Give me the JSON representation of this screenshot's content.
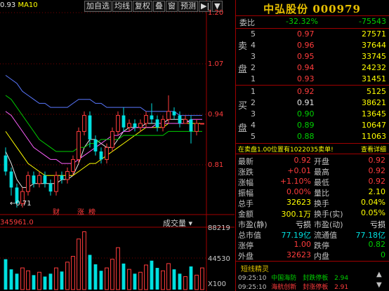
{
  "legend": {
    "ma_prefix": "0.93",
    "ma_label": "MA10"
  },
  "toolbar": [
    "加自选",
    "均线",
    "复权",
    "叠",
    "窗",
    "预测"
  ],
  "toolbar_icons": [
    "play-last-icon",
    "menu-arrow-icon"
  ],
  "price_axis": [
    "1.20",
    "1.07",
    "0.94",
    "0.81"
  ],
  "low_marker": "0.71",
  "chart_markers": [
    "财",
    "涨",
    "榜"
  ],
  "volume": {
    "header": "345961.0",
    "selector": "成交量",
    "axis": [
      "88219",
      "44530",
      "X100"
    ]
  },
  "stock": {
    "name": "中弘股份",
    "code": "000979"
  },
  "committee": {
    "label": "委比",
    "ratio": "-32.32%",
    "diff": "-75543"
  },
  "sell_side_label": [
    "卖",
    "盘"
  ],
  "buy_side_label": [
    "买",
    "盘"
  ],
  "sell_orders": [
    {
      "level": "5",
      "price": "0.97",
      "volume": "27571"
    },
    {
      "level": "4",
      "price": "0.96",
      "volume": "37644"
    },
    {
      "level": "3",
      "price": "0.95",
      "volume": "33745"
    },
    {
      "level": "2",
      "price": "0.94",
      "volume": "24232"
    },
    {
      "level": "1",
      "price": "0.93",
      "volume": "31451"
    }
  ],
  "buy_orders": [
    {
      "level": "1",
      "price": "0.92",
      "volume": "5125"
    },
    {
      "level": "2",
      "price": "0.91",
      "volume": "38621"
    },
    {
      "level": "3",
      "price": "0.90",
      "volume": "13645"
    },
    {
      "level": "4",
      "price": "0.89",
      "volume": "10647"
    },
    {
      "level": "5",
      "price": "0.88",
      "volume": "11063"
    }
  ],
  "hint": {
    "text_a": "在卖盘1.00位置有",
    "amount": "1022035",
    "text_b": "卖单!",
    "link": "查看详细"
  },
  "stats_left": [
    {
      "label": "最新",
      "value": "0.92"
    },
    {
      "label": "涨跌",
      "value": "+0.01"
    },
    {
      "label": "涨幅",
      "value": "+1.10%"
    },
    {
      "label": "振幅",
      "value": "0.00%"
    },
    {
      "label": "总手",
      "value": "32623"
    },
    {
      "label": "金额",
      "value": "300.1万"
    },
    {
      "label": "市盈(静)",
      "value": "亏损"
    },
    {
      "label": "总市值",
      "value": "77.19亿"
    },
    {
      "label": "涨停",
      "value": "1.00"
    },
    {
      "label": "外盘",
      "value": "32623"
    }
  ],
  "stats_right": [
    {
      "label": "开盘",
      "value": "0.92"
    },
    {
      "label": "最高",
      "value": "0.92"
    },
    {
      "label": "最低",
      "value": "0.92"
    },
    {
      "label": "量比",
      "value": "2.10"
    },
    {
      "label": "换手",
      "value": "0.04%"
    },
    {
      "label": "换手(实)",
      "value": "0.05%"
    },
    {
      "label": "市盈(动)",
      "value": "亏损"
    },
    {
      "label": "流通值",
      "value": "77.18亿"
    },
    {
      "label": "跌停",
      "value": "0.82"
    },
    {
      "label": "内盘",
      "value": "0"
    }
  ],
  "news": {
    "header": "短线精灵",
    "items": [
      {
        "time": "09:25:10",
        "name": "中国海防",
        "event": "封跌停板",
        "value": "2.94"
      },
      {
        "time": "09:25:10",
        "name": "海航创新",
        "event": "封涨停板",
        "value": "2.91"
      }
    ]
  },
  "colors": {
    "up": "#ff3c3c",
    "down": "#00e0e0",
    "flat": "#e8e8e8",
    "title": "#e8c000"
  },
  "chart_data": {
    "type": "candlestick",
    "y_range": [
      0.71,
      1.2
    ],
    "candles": [
      {
        "o": 0.84,
        "c": 0.8,
        "h": 0.86,
        "l": 0.79
      },
      {
        "o": 0.8,
        "c": 0.76,
        "h": 0.81,
        "l": 0.74
      },
      {
        "o": 0.76,
        "c": 0.72,
        "h": 0.77,
        "l": 0.71
      },
      {
        "o": 0.72,
        "c": 0.75,
        "h": 0.76,
        "l": 0.71
      },
      {
        "o": 0.75,
        "c": 0.79,
        "h": 0.8,
        "l": 0.74
      },
      {
        "o": 0.79,
        "c": 0.77,
        "h": 0.8,
        "l": 0.76
      },
      {
        "o": 0.77,
        "c": 0.79,
        "h": 0.8,
        "l": 0.76
      },
      {
        "o": 0.79,
        "c": 0.77,
        "h": 0.8,
        "l": 0.76
      },
      {
        "o": 0.77,
        "c": 0.75,
        "h": 0.78,
        "l": 0.74
      },
      {
        "o": 0.75,
        "c": 0.79,
        "h": 0.8,
        "l": 0.74
      },
      {
        "o": 0.79,
        "c": 0.78,
        "h": 0.8,
        "l": 0.77
      },
      {
        "o": 0.78,
        "c": 0.8,
        "h": 0.81,
        "l": 0.77
      },
      {
        "o": 0.8,
        "c": 0.83,
        "h": 0.84,
        "l": 0.79
      },
      {
        "o": 0.83,
        "c": 0.9,
        "h": 0.91,
        "l": 0.82
      },
      {
        "o": 0.9,
        "c": 0.94,
        "h": 0.95,
        "l": 0.89
      },
      {
        "o": 0.94,
        "c": 0.88,
        "h": 0.95,
        "l": 0.86
      },
      {
        "o": 0.88,
        "c": 0.85,
        "h": 0.89,
        "l": 0.84
      },
      {
        "o": 0.85,
        "c": 0.83,
        "h": 0.86,
        "l": 0.82
      },
      {
        "o": 0.83,
        "c": 0.86,
        "h": 0.87,
        "l": 0.82
      },
      {
        "o": 0.86,
        "c": 0.9,
        "h": 0.91,
        "l": 0.85
      },
      {
        "o": 0.9,
        "c": 0.94,
        "h": 0.95,
        "l": 0.89
      },
      {
        "o": 0.94,
        "c": 0.91,
        "h": 0.96,
        "l": 0.9
      },
      {
        "o": 0.91,
        "c": 0.92,
        "h": 0.93,
        "l": 0.9
      },
      {
        "o": 0.92,
        "c": 0.91,
        "h": 0.93,
        "l": 0.9
      },
      {
        "o": 0.91,
        "c": 0.92,
        "h": 0.93,
        "l": 0.9
      },
      {
        "o": 0.92,
        "c": 0.94,
        "h": 0.95,
        "l": 0.91
      },
      {
        "o": 0.94,
        "c": 0.93,
        "h": 0.97,
        "l": 0.92
      },
      {
        "o": 0.93,
        "c": 0.91,
        "h": 0.94,
        "l": 0.9
      },
      {
        "o": 0.91,
        "c": 0.93,
        "h": 0.94,
        "l": 0.9
      },
      {
        "o": 0.93,
        "c": 0.95,
        "h": 0.99,
        "l": 0.92
      },
      {
        "o": 0.95,
        "c": 0.94,
        "h": 0.96,
        "l": 0.93
      },
      {
        "o": 0.94,
        "c": 0.92,
        "h": 0.95,
        "l": 0.91
      },
      {
        "o": 0.92,
        "c": 0.93,
        "h": 0.94,
        "l": 0.92
      },
      {
        "o": 0.93,
        "c": 0.9,
        "h": 0.94,
        "l": 0.87
      },
      {
        "o": 0.9,
        "c": 0.92,
        "h": 0.93,
        "l": 0.89
      },
      {
        "o": 0.92,
        "c": 0.92,
        "h": 0.92,
        "l": 0.92
      }
    ],
    "volumes": [
      42000,
      28000,
      22000,
      30000,
      26000,
      20000,
      24000,
      18000,
      22000,
      30000,
      25000,
      38000,
      46000,
      70000,
      80000,
      48000,
      35000,
      26000,
      30000,
      42000,
      58000,
      36000,
      28000,
      22000,
      24000,
      34000,
      40000,
      30000,
      26000,
      36000,
      28000,
      22000,
      18000,
      32000,
      20000,
      30000
    ],
    "volume_range": [
      0,
      88219
    ],
    "ma": [
      {
        "color": "#e8e8e8",
        "values": [
          0.85,
          0.82,
          0.78,
          0.76,
          0.76,
          0.77,
          0.77,
          0.77,
          0.77,
          0.77,
          0.78,
          0.78,
          0.79,
          0.82,
          0.86,
          0.88,
          0.88,
          0.87,
          0.86,
          0.86,
          0.88,
          0.9,
          0.91,
          0.91,
          0.91,
          0.92,
          0.92,
          0.92,
          0.92,
          0.93,
          0.93,
          0.93,
          0.93,
          0.92,
          0.92,
          0.92
        ]
      },
      {
        "color": "#ffff00",
        "values": [
          0.9,
          0.88,
          0.86,
          0.84,
          0.82,
          0.81,
          0.8,
          0.79,
          0.79,
          0.79,
          0.79,
          0.79,
          0.79,
          0.8,
          0.81,
          0.82,
          0.82,
          0.83,
          0.84,
          0.85,
          0.86,
          0.87,
          0.88,
          0.89,
          0.9,
          0.91,
          0.91,
          0.91,
          0.91,
          0.92,
          0.92,
          0.92,
          0.92,
          0.92,
          0.92,
          0.92
        ]
      },
      {
        "color": "#ff60ff",
        "values": [
          0.95,
          0.94,
          0.92,
          0.9,
          0.88,
          0.86,
          0.85,
          0.84,
          0.83,
          0.83,
          0.82,
          0.82,
          0.82,
          0.83,
          0.84,
          0.85,
          0.86,
          0.87,
          0.88,
          0.89,
          0.89,
          0.9,
          0.9,
          0.91,
          0.91,
          0.91,
          0.91,
          0.92,
          0.92,
          0.92,
          0.92,
          0.92,
          0.92,
          0.93,
          0.93,
          0.93
        ]
      },
      {
        "color": "#00d000",
        "values": [
          0.99,
          0.98,
          0.96,
          0.94,
          0.92,
          0.9,
          0.88,
          0.87,
          0.86,
          0.85,
          0.85,
          0.85,
          0.85,
          0.86,
          0.86,
          0.87,
          0.87,
          0.88,
          0.88,
          0.88,
          0.88,
          0.89,
          0.89,
          0.89,
          0.89,
          0.89,
          0.89,
          0.89,
          0.89,
          0.9,
          0.9,
          0.9,
          0.9,
          0.9,
          0.9,
          0.9
        ]
      },
      {
        "color": "#5a78ff",
        "values": [
          1.04,
          1.03,
          1.02,
          1.0,
          0.99,
          0.98,
          0.97,
          0.97,
          0.96,
          0.96,
          0.96,
          0.96,
          0.97,
          0.98,
          0.98,
          0.98,
          0.97,
          0.97,
          0.96,
          0.96,
          0.96,
          0.96,
          0.96,
          0.96,
          0.96,
          0.95,
          0.95,
          0.95,
          0.95,
          0.95,
          0.95,
          0.94,
          0.94,
          0.94,
          0.94,
          0.94
        ]
      }
    ]
  }
}
